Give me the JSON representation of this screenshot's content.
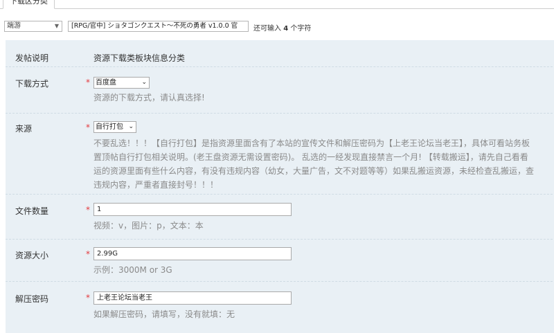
{
  "tab": {
    "label": "下载区分类"
  },
  "topbar": {
    "game_type": "端游",
    "title_value": "[RPG/官中] ショタゴンクエスト～不死の勇者 v1.0.0 官",
    "remain_prefix": "还可输入 ",
    "remain_count": "4",
    "remain_suffix": " 个字符"
  },
  "form": {
    "post_note": {
      "label": "发帖说明",
      "text": "资源下载类板块信息分类"
    },
    "download_method": {
      "label": "下载方式",
      "value": "百度盘",
      "hint": "资源的下载方式，请认真选择!"
    },
    "source": {
      "label": "来源",
      "value": "自行打包",
      "hint_lines": [
        "不要乱选！！！【自行打包】是指资源里面含有了本站的宣传文件和解压密码为【上老王论坛当老王】，具体可看站务板",
        "置顶帖自行打包相关说明。(老王盘资源无需设置密码)。 乱选的一经发现直接禁言一个月! 【转载搬运】，请先自己看看",
        "运的资源里面有些什么内容，有没有违规内容（幼女，大量广告，文不对题等等）如果乱搬运资源，未经检查乱搬运，查",
        "违规内容，严重者直接封号！！！"
      ]
    },
    "file_count": {
      "label": "文件数量",
      "value": "1",
      "hint": "视频：v，图片：p，文本：本"
    },
    "size": {
      "label": "资源大小",
      "value": "2.99G",
      "hint": "示例：3000M or 3G"
    },
    "password": {
      "label": "解压密码",
      "value": "上老王论坛当老王",
      "hint": "如果解压密码，请填写，没有就填：无"
    }
  },
  "required_mark": "*",
  "colors": {
    "panel_bg": "#e9f0f5",
    "required": "#e4393c",
    "hint": "#8a8a8a"
  }
}
